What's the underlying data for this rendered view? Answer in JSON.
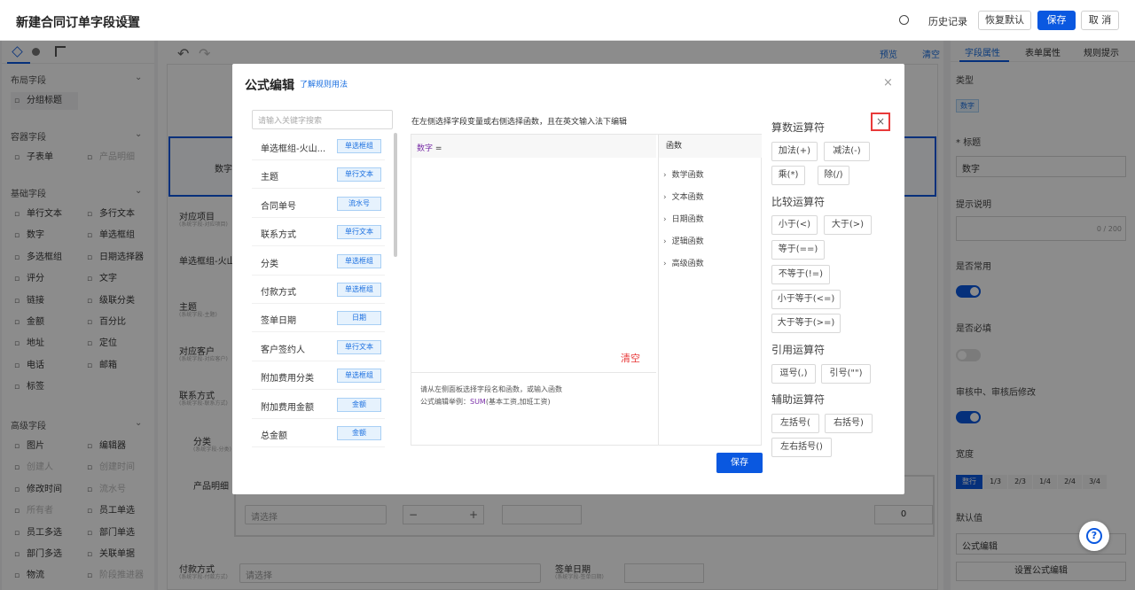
{
  "header": {
    "title": "新建合同订单字段设置",
    "history": "历史记录",
    "restore": "恢复默认",
    "save": "保存",
    "cancel": "取 消"
  },
  "left_panel": {
    "sections": [
      {
        "name": "布局字段",
        "items": [
          "分组标题"
        ]
      },
      {
        "name": "容器字段",
        "items": [
          "子表单",
          "产品明细"
        ]
      },
      {
        "name": "基础字段",
        "items": [
          "单行文本",
          "多行文本",
          "数字",
          "单选框组",
          "多选框组",
          "日期选择器",
          "评分",
          "文字",
          "链接",
          "级联分类",
          "金额",
          "百分比",
          "地址",
          "定位",
          "电话",
          "邮箱",
          "标签"
        ]
      },
      {
        "name": "高级字段",
        "items": [
          "图片",
          "编辑器",
          "创建人",
          "创建时间",
          "修改时间",
          "流水号",
          "所有者",
          "员工单选",
          "员工多选",
          "部门单选",
          "部门多选",
          "关联单据",
          "物流",
          "阶段推进器"
        ]
      }
    ]
  },
  "canvas": {
    "preview": "预览",
    "clear": "清空",
    "rows": [
      {
        "label": "数字"
      },
      {
        "label": "对应项目",
        "sub": "(系统字段-对应项目)"
      },
      {
        "label": "单选框组-火山测试"
      },
      {
        "label": "主题",
        "sub": "(系统字段-主题)"
      },
      {
        "label": "对应客户",
        "sub": "(系统字段-对应客户)"
      },
      {
        "label": "联系方式",
        "sub": "(系统字段-联系方式)"
      },
      {
        "label": "分类",
        "sub": "(系统字段-分类)"
      },
      {
        "label": "产品明细"
      },
      {
        "label": "付款方式",
        "sub": "(系统字段-付款方式)"
      },
      {
        "label": "签单日期",
        "sub": "(系统字段-签单日期)"
      }
    ],
    "select_placeholder": "请选择",
    "stepper_value": "0"
  },
  "right_panel": {
    "tabs": [
      "字段属性",
      "表单属性",
      "规则提示"
    ],
    "type_label": "类型",
    "type_value": "数字",
    "title_label": "标题",
    "title_value": "数字",
    "desc_label": "提示说明",
    "desc_count": "0 / 200",
    "common_label": "是否常用",
    "required_label": "是否必填",
    "editable_label": "审核中、审核后修改",
    "width_label": "宽度",
    "widths": [
      "整行",
      "1/3",
      "2/3",
      "1/4",
      "2/4",
      "3/4"
    ],
    "default_label": "默认值",
    "default_value": "公式编辑",
    "formula_button": "设置公式编辑"
  },
  "modal": {
    "title": "公式编辑",
    "help_link": "了解规则用法",
    "search_placeholder": "请输入关键字搜索",
    "instruction": "在左侧选择字段变量或右侧选择函数，且在英文输入法下编辑",
    "formula_field": "数字",
    "formula_eq": "=",
    "clear": "清空",
    "hint1": "请从左侧面板选择字段名和函数，或输入函数",
    "hint2_prefix": "公式编辑举例：",
    "hint2_fn": "SUM",
    "hint2_args": "(基本工资,加班工资)",
    "save": "保存",
    "functions_title": "函数",
    "functions": [
      "数学函数",
      "文本函数",
      "日期函数",
      "逻辑函数",
      "高级函数"
    ],
    "fields": [
      {
        "name": "单选框组-火山...",
        "type": "单选框组"
      },
      {
        "name": "主题",
        "type": "单行文本"
      },
      {
        "name": "合同单号",
        "type": "流水号"
      },
      {
        "name": "联系方式",
        "type": "单行文本"
      },
      {
        "name": "分类",
        "type": "单选框组"
      },
      {
        "name": "付款方式",
        "type": "单选框组"
      },
      {
        "name": "签单日期",
        "type": "日期"
      },
      {
        "name": "客户签约人",
        "type": "单行文本"
      },
      {
        "name": "附加费用分类",
        "type": "单选框组"
      },
      {
        "name": "附加费用金额",
        "type": "金额"
      },
      {
        "name": "总金额",
        "type": "金额"
      }
    ],
    "op_groups": {
      "arith_title": "算数运算符",
      "arith": [
        "加法(+)",
        "减法(-)",
        "乘(*)",
        "除(/)"
      ],
      "compare_title": "比较运算符",
      "compare": [
        "小于(<)",
        "大于(>)",
        "等于(==)",
        "不等于(!=)",
        "小于等于(<=)",
        "大于等于(>=)"
      ],
      "quote_title": "引用运算符",
      "quote": [
        "逗号(,)",
        "引号(\"\")"
      ],
      "aux_title": "辅助运算符",
      "aux": [
        "左括号(",
        "右括号)",
        "左右括号()"
      ]
    }
  },
  "colors": {
    "primary": "#0a58e0",
    "red": "#e83a3a",
    "purple": "#7a2fa8"
  }
}
